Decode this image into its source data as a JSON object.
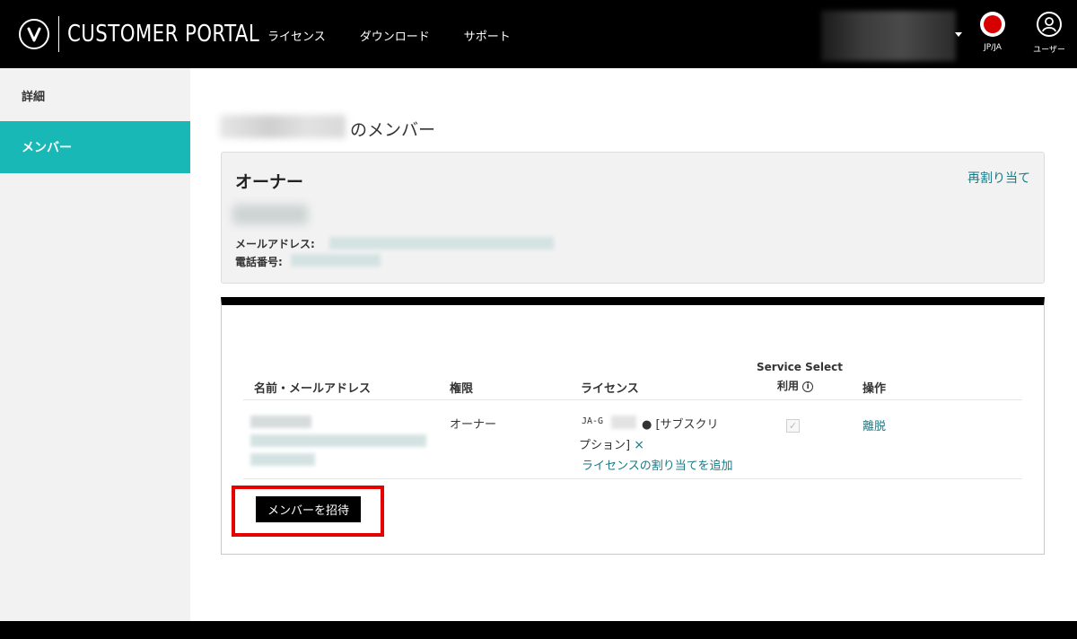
{
  "header": {
    "brand": "CUSTOMER PORTAL",
    "logo_letter": "V",
    "nav": [
      "ライセンス",
      "ダウンロード",
      "サポート"
    ],
    "locale": "JP/JA",
    "user_label": "ユーザー"
  },
  "sidebar": {
    "items": [
      {
        "label": "詳細",
        "active": false
      },
      {
        "label": "メンバー",
        "active": true
      }
    ]
  },
  "main": {
    "title_suffix": "のメンバー",
    "owner": {
      "heading": "オーナー",
      "reassign_label": "再割り当て",
      "email_label": "メールアドレス:",
      "phone_label": "電話番号:"
    },
    "table": {
      "headers": {
        "name": "名前・メールアドレス",
        "role": "権限",
        "license": "ライセンス",
        "service_select_line1": "Service Select",
        "service_select_line2": "利用",
        "actions": "操作"
      },
      "row": {
        "role": "オーナー",
        "license_prefix": "JA-G",
        "license_text_line1": "● [サブスクリ",
        "license_text_line2": "プション]",
        "remove_icon": "×",
        "add_license": "ライセンスの割り当てを追加",
        "service_checked": true,
        "action": "離脱"
      }
    },
    "invite_button": "メンバーを招待"
  },
  "colors": {
    "accent": "#17b8b5",
    "link": "#1a7a86",
    "highlight": "#e60000"
  }
}
